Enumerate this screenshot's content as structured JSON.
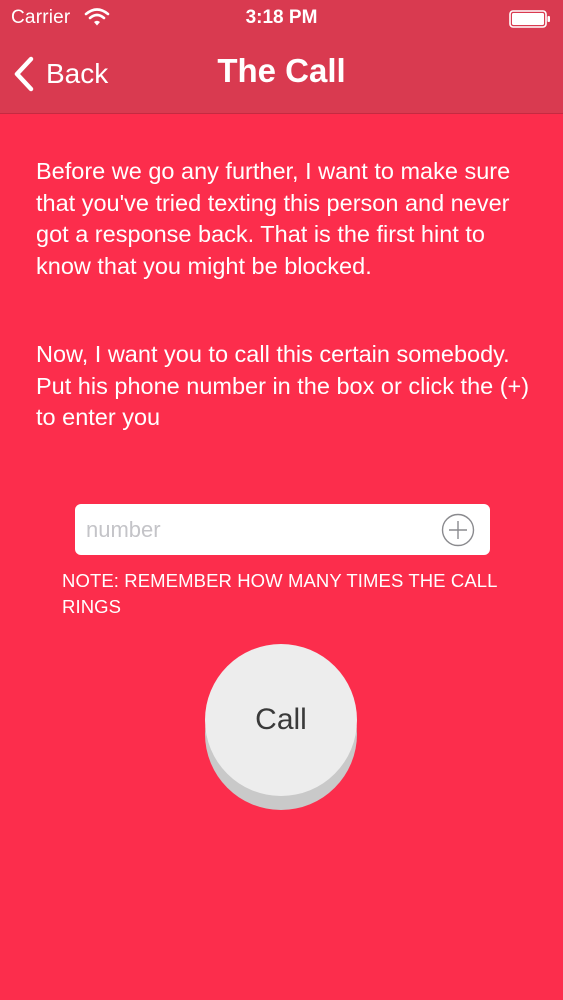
{
  "status_bar": {
    "carrier": "Carrier",
    "time": "3:18 PM",
    "wifi_icon": "wifi-icon",
    "battery_icon": "battery-icon"
  },
  "nav": {
    "back_label": "Back",
    "back_icon": "chevron-left-icon",
    "title": "The Call"
  },
  "content": {
    "paragraph_1": "Before we go any further, I want to make sure that you've tried texting this person and never got a response back. That is the first hint to know that you might be blocked.",
    "paragraph_2": "Now, I want you to call this certain somebody. Put his phone number in the box or click the (+) to enter you",
    "number_input": {
      "value": "",
      "placeholder": "number"
    },
    "add_contact_icon": "plus-circle-icon",
    "note": "NOTE: REMEMBER HOW MANY TIMES THE CALL RINGS",
    "call_button_label": "Call"
  },
  "colors": {
    "background": "#FC2D4C",
    "nav_bar": "#D93A50",
    "button": "#EDEDED"
  }
}
